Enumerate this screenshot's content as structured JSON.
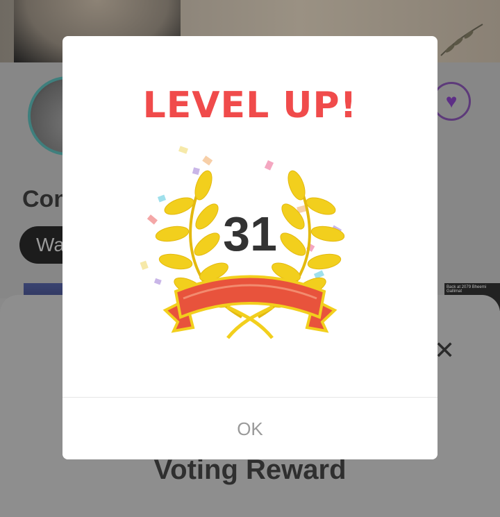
{
  "background": {
    "profile_name": "Con",
    "pill_button_label": "Wa",
    "thumbnail_caption": "Back at 2079 Bheemi Gallimat",
    "sheet_title": "Voting Reward",
    "sheet_close_glyph": "✕",
    "heart_glyph": "♥"
  },
  "modal": {
    "title": "LEVEL UP!",
    "level": "31",
    "ok_label": "OK"
  },
  "colors": {
    "title_red": "#f04b4b",
    "laurel_yellow": "#f2cf1d",
    "ribbon_red": "#e8533c",
    "ribbon_border": "#f2cf1d",
    "level_text": "#333333",
    "ok_text": "#9a9a9a"
  }
}
